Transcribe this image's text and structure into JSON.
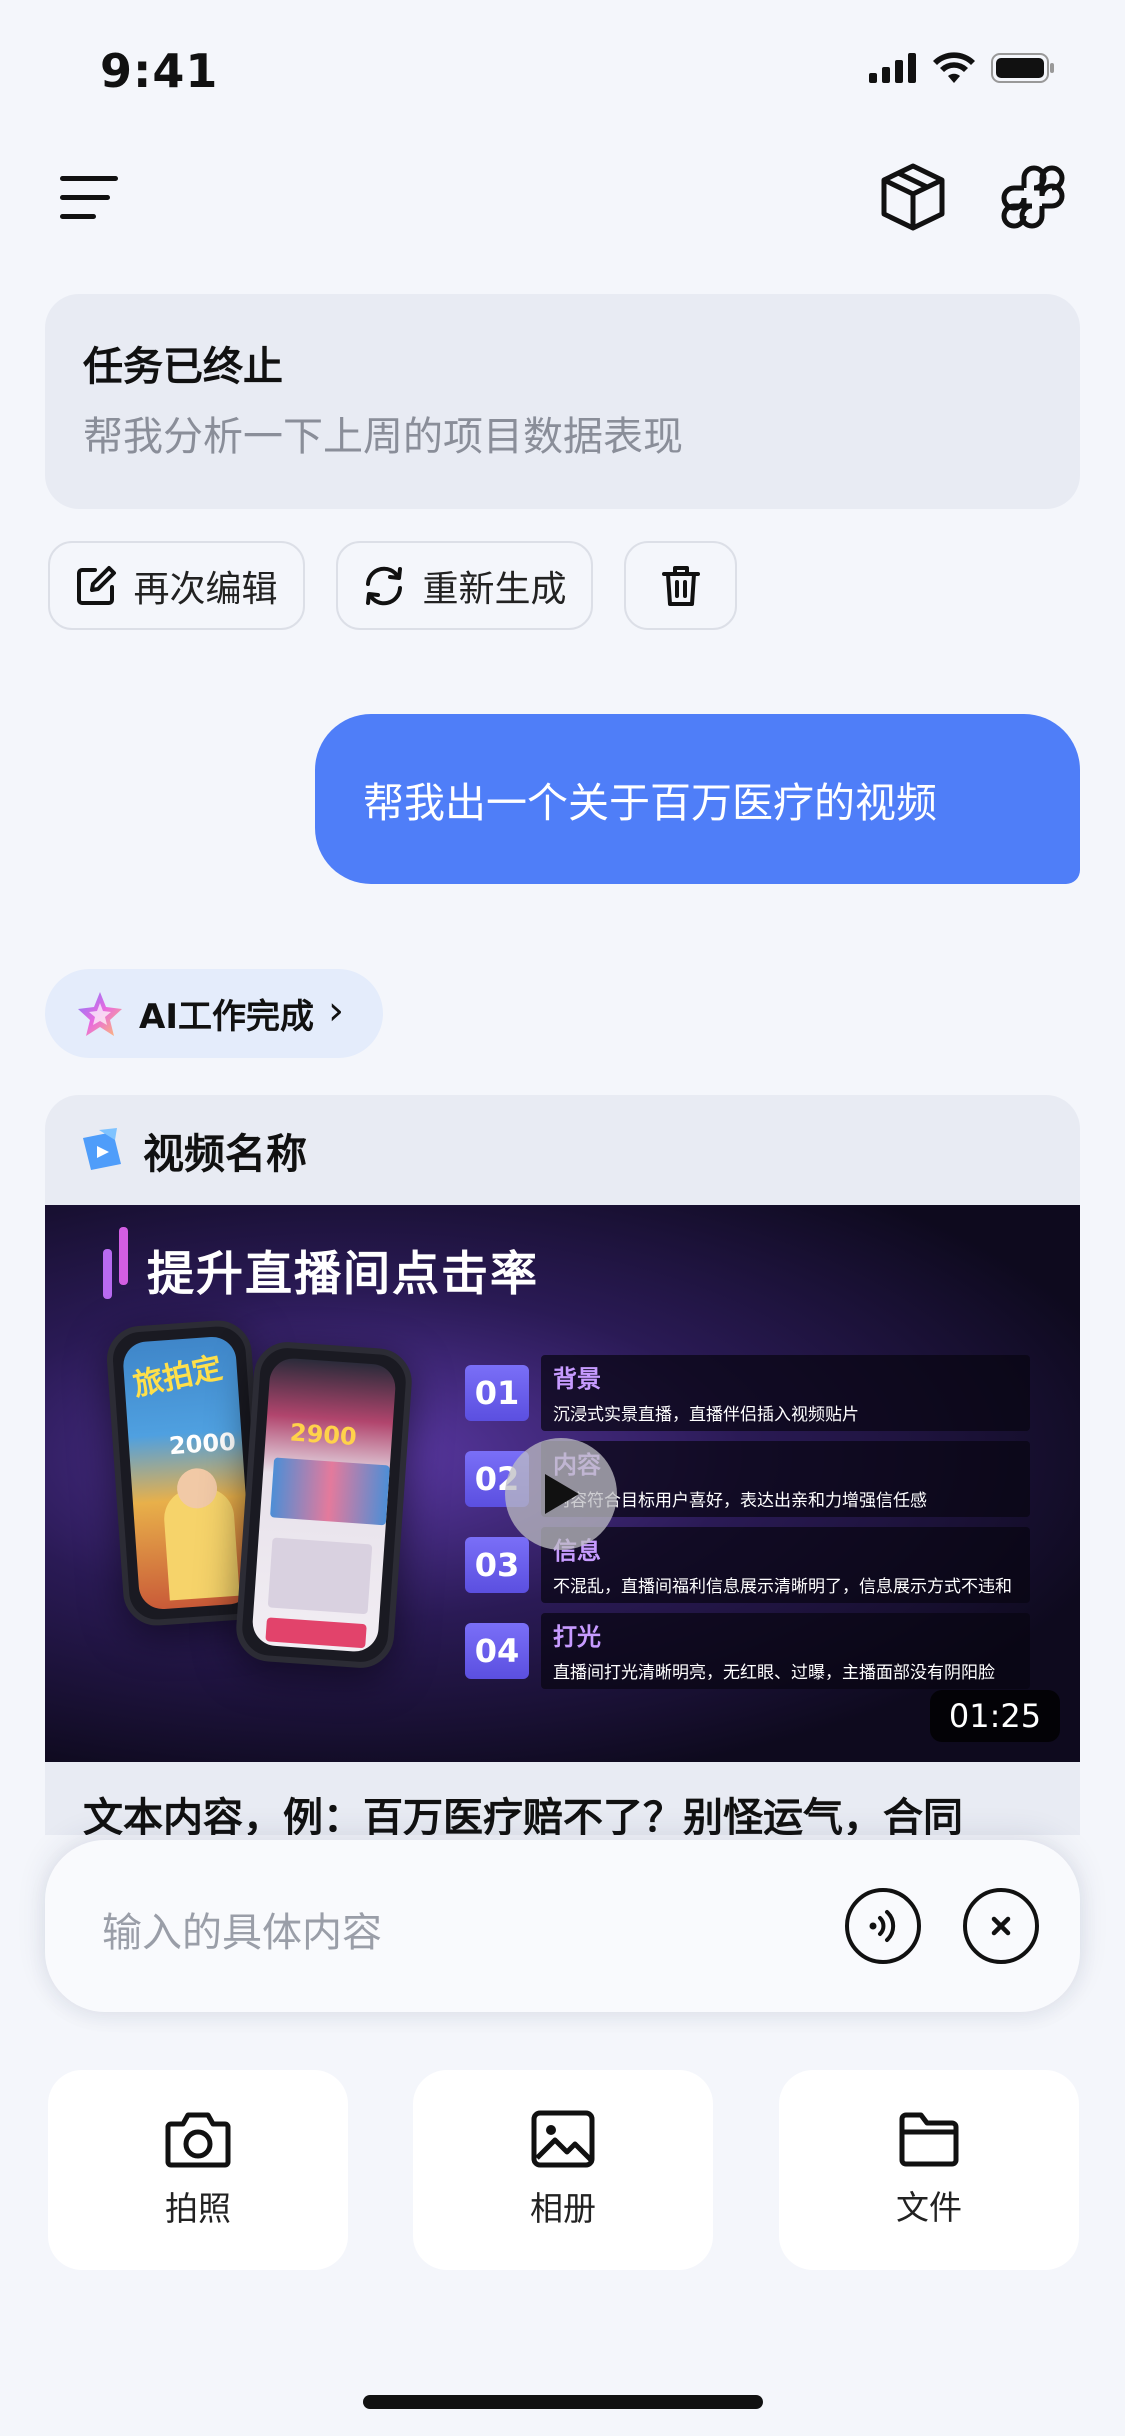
{
  "status_bar": {
    "time": "9:41"
  },
  "task_card": {
    "status": "任务已终止",
    "query": "帮我分析一下上周的项目数据表现"
  },
  "task_actions": {
    "edit_label": "再次编辑",
    "regenerate_label": "重新生成"
  },
  "user_message": "帮我出一个关于百万医疗的视频",
  "ai_chip": {
    "label": "AI工作完成",
    "chevron": "›"
  },
  "video_card": {
    "title": "视频名称",
    "thumbnail": {
      "headline": "提升直播间点击率",
      "points": [
        {
          "num": "01",
          "head": "背景",
          "desc": "沉浸式实景直播，直播伴侣插入视频贴片"
        },
        {
          "num": "02",
          "head": "内容",
          "desc": "内容符合目标用户喜好，表达出亲和力增强信任感"
        },
        {
          "num": "03",
          "head": "信息",
          "desc": "不混乱，直播间福利信息展示清晰明了，信息展示方式不违和"
        },
        {
          "num": "04",
          "head": "打光",
          "desc": "直播间打光清晰明亮，无红眼、过曝，主播面部没有阴阳脸"
        }
      ],
      "phone1_text": "旅拍定",
      "phone1_price": "2000",
      "phone2_price": "2900"
    },
    "duration": "01:25",
    "text_preview": "文本内容，例：百万医疗赔不了？别怪运气，合同"
  },
  "input": {
    "placeholder": "输入的具体内容"
  },
  "tiles": [
    {
      "label": "拍照",
      "icon": "camera-icon"
    },
    {
      "label": "相册",
      "icon": "image-icon"
    },
    {
      "label": "文件",
      "icon": "folder-icon"
    }
  ],
  "colors": {
    "accent": "#4f7ef8",
    "card_bg": "#e8ebf3",
    "page_bg": "#f4f6fb"
  }
}
